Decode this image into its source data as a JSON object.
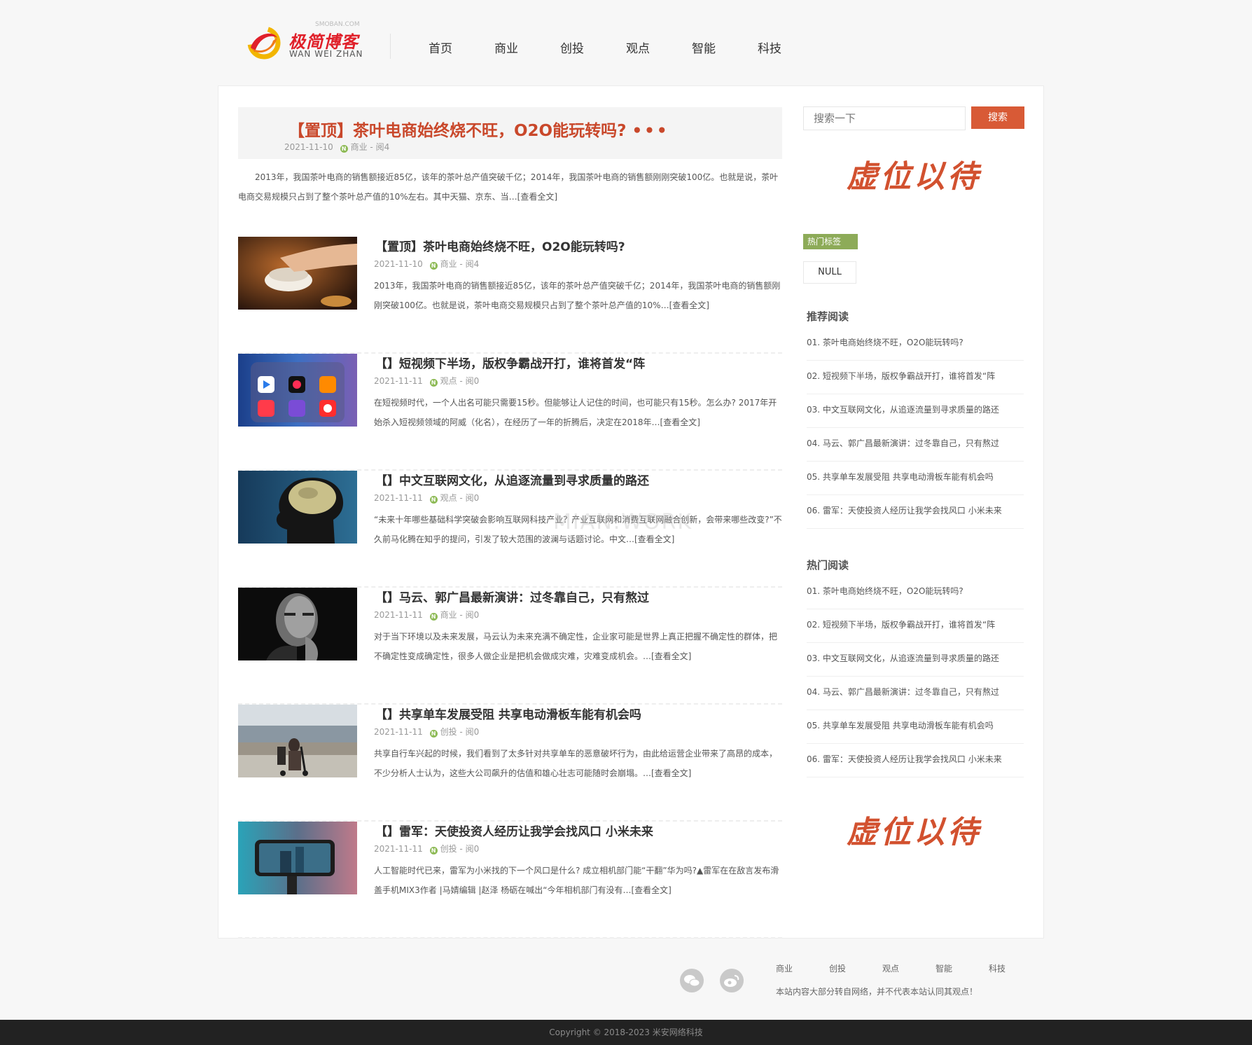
{
  "site": {
    "logo_cn": "极简博客",
    "logo_en": "WAN WEI ZHAN",
    "logo_small": "SMOBAN.COM"
  },
  "nav": [
    "首页",
    "商业",
    "创投",
    "观点",
    "智能",
    "科技"
  ],
  "pinned": {
    "title": "【置顶】茶叶电商始终烧不旺，O2O能玩转吗?",
    "dots": "•••",
    "date": "2021-11-10",
    "category": "商业",
    "views": "阅4",
    "excerpt": "2013年，我国茶叶电商的销售额接近85亿，该年的茶叶总产值突破千亿；2014年，我国茶叶电商的销售额刚刚突破100亿。也就是说，茶叶电商交易规模只占到了整个茶叶总产值的10%左右。其中天猫、京东、当…[查看全文]"
  },
  "articles": [
    {
      "title": "【置顶】茶叶电商始终烧不旺，O2O能玩转吗?",
      "date": "2021-11-10",
      "category": "商业",
      "views": "阅4",
      "excerpt": "2013年，我国茶叶电商的销售额接近85亿，该年的茶叶总产值突破千亿；2014年，我国茶叶电商的销售额刚刚突破100亿。也就是说，茶叶电商交易规模只占到了整个茶叶总产值的10%…[查看全文]",
      "thumb": "tea"
    },
    {
      "title": "【】短视频下半场，版权争霸战开打，谁将首发“阵",
      "date": "2021-11-11",
      "category": "观点",
      "views": "阅0",
      "excerpt": "在短视频时代，一个人出名可能只需要15秒。但能够让人记住的时间，也可能只有15秒。怎么办? 2017年开始杀入短视频领域的阿威（化名），在经历了一年的折腾后，决定在2018年…[查看全文]",
      "thumb": "apps"
    },
    {
      "title": "【】中文互联网文化，从追逐流量到寻求质量的路还",
      "date": "2021-11-11",
      "category": "观点",
      "views": "阅0",
      "excerpt": "“未来十年哪些基础科学突破会影响互联网科技产业？产业互联网和消费互联网融合创新，会带来哪些改变?”不久前马化腾在知乎的提问，引发了较大范围的波澜与话题讨论。中文…[查看全文]",
      "thumb": "brain"
    },
    {
      "title": "【】马云、郭广昌最新演讲：过冬靠自己，只有熬过",
      "date": "2021-11-11",
      "category": "商业",
      "views": "阅0",
      "excerpt": "对于当下环境以及未来发展，马云认为未来充满不确定性，企业家可能是世界上真正把握不确定性的群体，把不确定性变成确定性，很多人做企业是把机会做成灾难，灾难变成机会。…[查看全文]",
      "thumb": "portrait"
    },
    {
      "title": "【】共享单车发展受阻 共享电动滑板车能有机会吗",
      "date": "2021-11-11",
      "category": "创投",
      "views": "阅0",
      "excerpt": "共享自行车兴起的时候，我们看到了太多针对共享单车的恶意破坏行为，由此给运营企业带来了高昂的成本，不少分析人士认为，这些大公司飙升的估值和雄心壮志可能随时会崩塌。…[查看全文]",
      "thumb": "scooter"
    },
    {
      "title": "【】雷军：天使投资人经历让我学会找风口 小米未来",
      "date": "2021-11-11",
      "category": "创投",
      "views": "阅0",
      "excerpt": "人工智能时代已来，雷军为小米找的下一个风口是什么? 成立相机部门能“干翻”华为吗?▲雷军在在敌言发布滑盖手机MIX3作者 |马婧编辑 |赵泽 杨砺在喊出“今年相机部门有没有…[查看全文]",
      "thumb": "phone"
    }
  ],
  "sidebar": {
    "search_placeholder": "搜索一下",
    "search_button": "搜索",
    "ad_text": "虚位以待",
    "hot_tags_label": "热门标签",
    "tag_null": "NULL",
    "recommended_heading": "推荐阅读",
    "recommended": [
      "01. 茶叶电商始终烧不旺，O2O能玩转吗?",
      "02. 短视频下半场，版权争霸战开打，谁将首发“阵",
      "03. 中文互联网文化，从追逐流量到寻求质量的路还",
      "04. 马云、郭广昌最新演讲：过冬靠自己，只有熬过",
      "05. 共享单车发展受阻 共享电动滑板车能有机会吗",
      "06. 雷军：天使投资人经历让我学会找风口 小米未来"
    ],
    "popular_heading": "热门阅读",
    "popular": [
      "01. 茶叶电商始终烧不旺，O2O能玩转吗?",
      "02. 短视频下半场，版权争霸战开打，谁将首发“阵",
      "03. 中文互联网文化，从追逐流量到寻求质量的路还",
      "04. 马云、郭广昌最新演讲：过冬靠自己，只有熬过",
      "05. 共享单车发展受阻 共享电动滑板车能有机会吗",
      "06. 雷军：天使投资人经历让我学会找风口 小米未来"
    ]
  },
  "footer": {
    "nav": [
      "商业",
      "创投",
      "观点",
      "智能",
      "科技"
    ],
    "note": "本站内容大部分转自网络，并不代表本站认同其观点！",
    "copyright": "Copyright © 2018-2023 米安网络科技"
  },
  "watermark": "MIAN.WORK",
  "colors": {
    "accent": "#d85a36",
    "title_red": "#c9482b",
    "tag_green": "#8dab58",
    "meta_icon": "#8dba55"
  }
}
